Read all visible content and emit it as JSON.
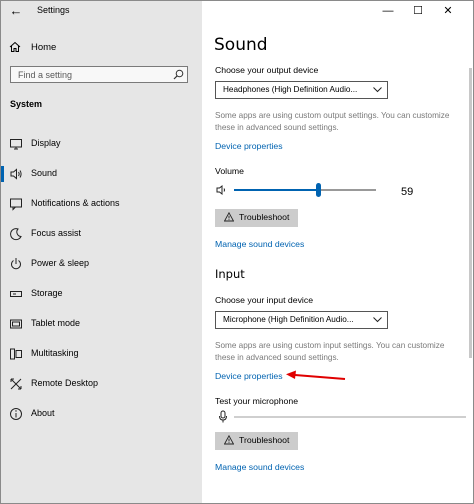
{
  "window": {
    "title": "Settings",
    "back_glyph": "←",
    "minimize_glyph": "—",
    "maximize_glyph": "☐",
    "close_glyph": "✕"
  },
  "sidebar": {
    "home_label": "Home",
    "search_placeholder": "Find a setting",
    "section_header": "System",
    "items": [
      {
        "label": "Display",
        "icon": "display-icon"
      },
      {
        "label": "Sound",
        "icon": "speaker-icon"
      },
      {
        "label": "Notifications & actions",
        "icon": "notification-icon"
      },
      {
        "label": "Focus assist",
        "icon": "moon-icon"
      },
      {
        "label": "Power & sleep",
        "icon": "power-icon"
      },
      {
        "label": "Storage",
        "icon": "storage-icon"
      },
      {
        "label": "Tablet mode",
        "icon": "tablet-icon"
      },
      {
        "label": "Multitasking",
        "icon": "multitasking-icon"
      },
      {
        "label": "Remote Desktop",
        "icon": "remote-desktop-icon"
      },
      {
        "label": "About",
        "icon": "info-icon"
      }
    ],
    "active_index": 1
  },
  "main": {
    "title": "Sound",
    "output": {
      "choose_label": "Choose your output device",
      "device": "Headphones (High Definition Audio...",
      "note": "Some apps are using custom output settings. You can customize these in advanced sound settings.",
      "device_properties": "Device properties",
      "volume_label": "Volume",
      "volume_value": "59",
      "volume_level": 0.59,
      "troubleshoot": "Troubleshoot",
      "manage": "Manage sound devices"
    },
    "input": {
      "section_title": "Input",
      "choose_label": "Choose your input device",
      "device": "Microphone (High Definition Audio...",
      "note": "Some apps are using custom input settings. You can customize these in advanced sound settings.",
      "device_properties": "Device properties",
      "test_label": "Test your microphone",
      "troubleshoot": "Troubleshoot",
      "manage": "Manage sound devices"
    }
  },
  "colors": {
    "accent": "#0063b1",
    "sidebar_bg": "#e6e6e6",
    "button_bg": "#cccccc",
    "annotation_arrow": "#e00000"
  }
}
